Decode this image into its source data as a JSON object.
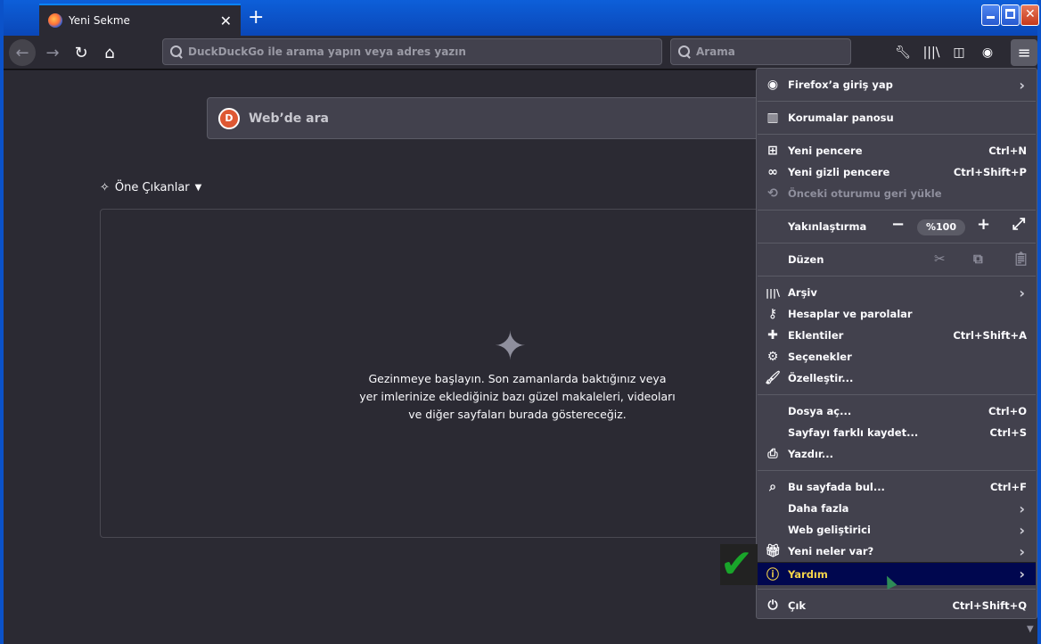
{
  "tab": {
    "title": "Yeni Sekme",
    "close_glyph": "✕",
    "new_tab_glyph": "+"
  },
  "navbar": {
    "url_placeholder": "DuckDuckGo ile arama yapın veya adres yazın",
    "search_placeholder": "Arama"
  },
  "content": {
    "web_search_label": "Web’de ara",
    "ddg_glyph": "D",
    "highlights_title": "Öne Çıkanlar",
    "empty_message": "Gezinmeye başlayın. Son zamanlarda baktığınız veya yer imlerinize eklediğiniz bazı güzel makaleleri, videoları ve diğer sayfaları burada göstereceğiz."
  },
  "menu": {
    "sign_in": "Firefox’a giriş yap",
    "protections": "Korumalar panosu",
    "new_window": {
      "label": "Yeni pencere",
      "shortcut": "Ctrl+N"
    },
    "new_private": {
      "label": "Yeni gizli pencere",
      "shortcut": "Ctrl+Shift+P"
    },
    "restore_session": "Önceki oturumu geri yükle",
    "zoom": {
      "label": "Yakınlaştırma",
      "value": "%100"
    },
    "edit": "Düzen",
    "library": "Arşiv",
    "logins": "Hesaplar ve parolalar",
    "addons": {
      "label": "Eklentiler",
      "shortcut": "Ctrl+Shift+A"
    },
    "options": "Seçenekler",
    "customize": "Özelleştir...",
    "open_file": {
      "label": "Dosya aç...",
      "shortcut": "Ctrl+O"
    },
    "save_page": {
      "label": "Sayfayı farklı kaydet...",
      "shortcut": "Ctrl+S"
    },
    "print": "Yazdır...",
    "find": {
      "label": "Bu sayfada bul...",
      "shortcut": "Ctrl+F"
    },
    "more": "Daha fazla",
    "web_dev": "Web geliştirici",
    "whats_new": "Yeni neler var?",
    "help": "Yardım",
    "quit": {
      "label": "Çık",
      "shortcut": "Ctrl+Shift+Q"
    }
  },
  "colors": {
    "accent": "#0a84ff",
    "highlight_bg": "#00074f",
    "highlight_text": "#f5d44a",
    "check": "#19a52a"
  }
}
